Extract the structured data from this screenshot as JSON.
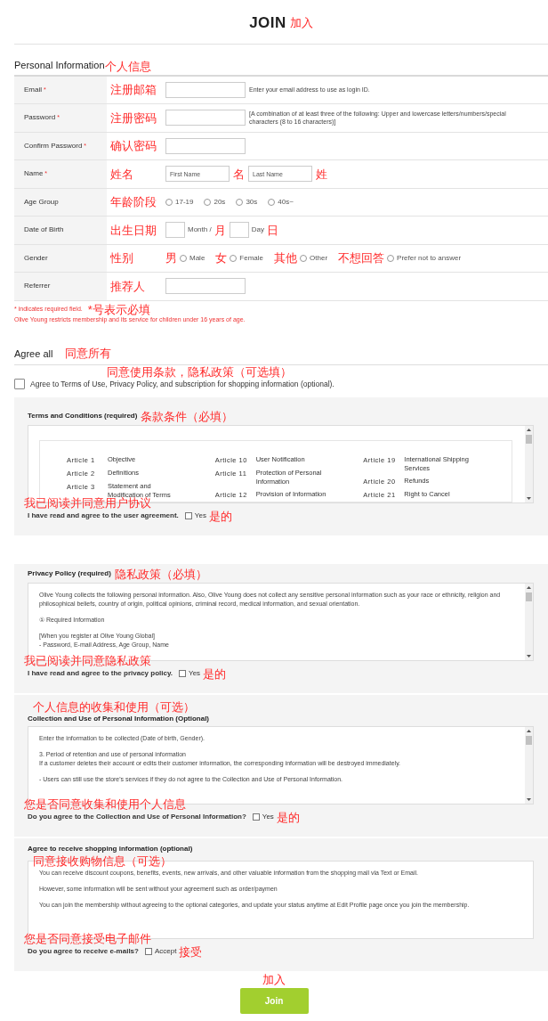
{
  "header": {
    "title": "JOIN",
    "note": "加入"
  },
  "personal": {
    "title": "Personal Information",
    "note": "个人信息",
    "rows": [
      {
        "kind": "text",
        "label": "Email",
        "required_mark": "*",
        "note": "注册邮箱",
        "hint": "Enter your email address to use as login ID."
      },
      {
        "kind": "text",
        "label": "Password",
        "required_mark": "*",
        "note": "注册密码",
        "hint": "[A combination of at least three of the following: Upper and lowercase letters/numbers/special characters (8 to 16 characters)]"
      },
      {
        "kind": "text",
        "label": "Confirm Password",
        "required_mark": "*",
        "note": "确认密码"
      },
      {
        "kind": "name",
        "label": "Name",
        "required_mark": "*",
        "note": "姓名",
        "fields": [
          {
            "placeholder": "First Name",
            "note": "名"
          },
          {
            "placeholder": "Last Name",
            "note": "姓"
          }
        ]
      },
      {
        "kind": "radio",
        "label": "Age Group",
        "note": "年龄阶段",
        "options": [
          {
            "label": "17-19",
            "selected": false
          },
          {
            "label": "20s",
            "selected": false
          },
          {
            "label": "30s",
            "selected": false
          },
          {
            "label": "40s~",
            "selected": false
          }
        ]
      },
      {
        "kind": "date",
        "label": "Date of Birth",
        "note": "出生日期",
        "parts": [
          {
            "unit": "Month /",
            "note": "月"
          },
          {
            "unit": "Day",
            "note": "日"
          }
        ]
      },
      {
        "kind": "radio",
        "label": "Gender",
        "note": "性别",
        "options": [
          {
            "label": "Male",
            "selected": false,
            "note": "男"
          },
          {
            "label": "Female",
            "selected": false,
            "note": "女"
          },
          {
            "label": "Other",
            "selected": false,
            "note": "其他"
          },
          {
            "label": "Prefer not to answer",
            "selected": false,
            "note": "不想回答"
          }
        ]
      },
      {
        "kind": "text",
        "label": "Referrer",
        "note": "推荐人"
      }
    ],
    "footnote": {
      "mark": "*",
      "text": "indicates required field.",
      "note": "*号表示必填"
    },
    "notice": "Olive Young restricts membership and its service for children under 16 years of age."
  },
  "agree_all": {
    "title": "Agree all",
    "note": "同意所有",
    "checkbox": {
      "note": "同意使用条款，隐私政策（可选填）",
      "label": "Agree to Terms of Use, Privacy Policy, and subscription for shopping information (optional).",
      "checked": false
    }
  },
  "sections": [
    {
      "kind": "articles",
      "title": "Terms and Conditions (required)",
      "title_note": "条款条件（必填）",
      "scrollable": true,
      "columns": [
        [
          {
            "number": "Article 1",
            "name": "Objective"
          },
          {
            "number": "Article 2",
            "name": "Definitions"
          },
          {
            "number": "Article 3",
            "name": "Statement and Modification of Terms"
          }
        ],
        [
          {
            "number": "Article 10",
            "name": "User Notification"
          },
          {
            "number": "Article 11",
            "name": "Protection of Personal Information"
          },
          {
            "number": "Article 12",
            "name": "Provision of Information"
          }
        ],
        [
          {
            "number": "Article 19",
            "name": "International Shipping Services"
          },
          {
            "number": "Article 20",
            "name": "Refunds"
          },
          {
            "number": "Article 21",
            "name": "Right to Cancel"
          }
        ]
      ],
      "confirm": {
        "note": "我已阅读并同意用户协议",
        "label": "I have read and agree to the user agreement.",
        "option": "Yes",
        "checked": false,
        "option_note": "是的"
      }
    },
    {
      "kind": "text",
      "title": "Privacy Policy (required)",
      "title_note": "隐私政策（必填）",
      "scrollable": true,
      "paragraphs": [
        [
          "Olive Young collects the following personal information. Also, Olive Young does not collect any sensitive personal information such as your race or ethnicity, religion and philosophical beliefs, country of origin, political opinions, criminal record, medical information, and sexual orientation."
        ],
        [
          "① Required Information"
        ],
        [
          "[When you register at Olive Young Global]",
          "- Password, E-mail Address, Age Group, Name"
        ]
      ],
      "confirm": {
        "note": "我已阅读并同意隐私政策",
        "label": "I have read and agree to the privacy policy.",
        "option": "Yes",
        "checked": false,
        "option_note": "是的"
      }
    },
    {
      "kind": "text",
      "title": "Collection and Use of Personal Information (Optional)",
      "note_above": "个人信息的收集和使用（可选）",
      "scrollable": true,
      "paragraphs": [
        [
          "Enter the information to be collected (Date of birth, Gender)."
        ],
        [
          "3. Period of retention and use of personal information",
          "If a customer deletes their account or edits their customer information, the corresponding information will be destroyed immediately."
        ],
        [
          "- Users can still use the store's services if they do not agree to the Collection and Use of Personal Information."
        ]
      ],
      "confirm": {
        "note": "您是否同意收集和使用个人信息",
        "label": "Do you agree to the Collection and Use of Personal Information?",
        "option": "Yes",
        "checked": false,
        "option_note": "是的"
      }
    },
    {
      "kind": "text",
      "title": "Agree to receive shopping information (optional)",
      "note_below": "同意接收购物信息（可选）",
      "scrollable": false,
      "paragraphs": [
        [
          "You can receive discount coupons, benefits, events, new arrivals, and other valuable information from the shopping mall via Text or Email."
        ],
        [
          "However, some information will be sent without your agreement such as order/paymen"
        ],
        [
          "You can join the membership without agreeing to the optional categories, and update your status anytime at Edit Profile page once you join the membership."
        ]
      ],
      "confirm": {
        "note": "您是否同意接受电子邮件",
        "label": "Do you agree to receive e-mails?",
        "option": "Accept",
        "checked": false,
        "option_note": "接受"
      }
    }
  ],
  "join": {
    "note": "加入",
    "label": "Join"
  }
}
